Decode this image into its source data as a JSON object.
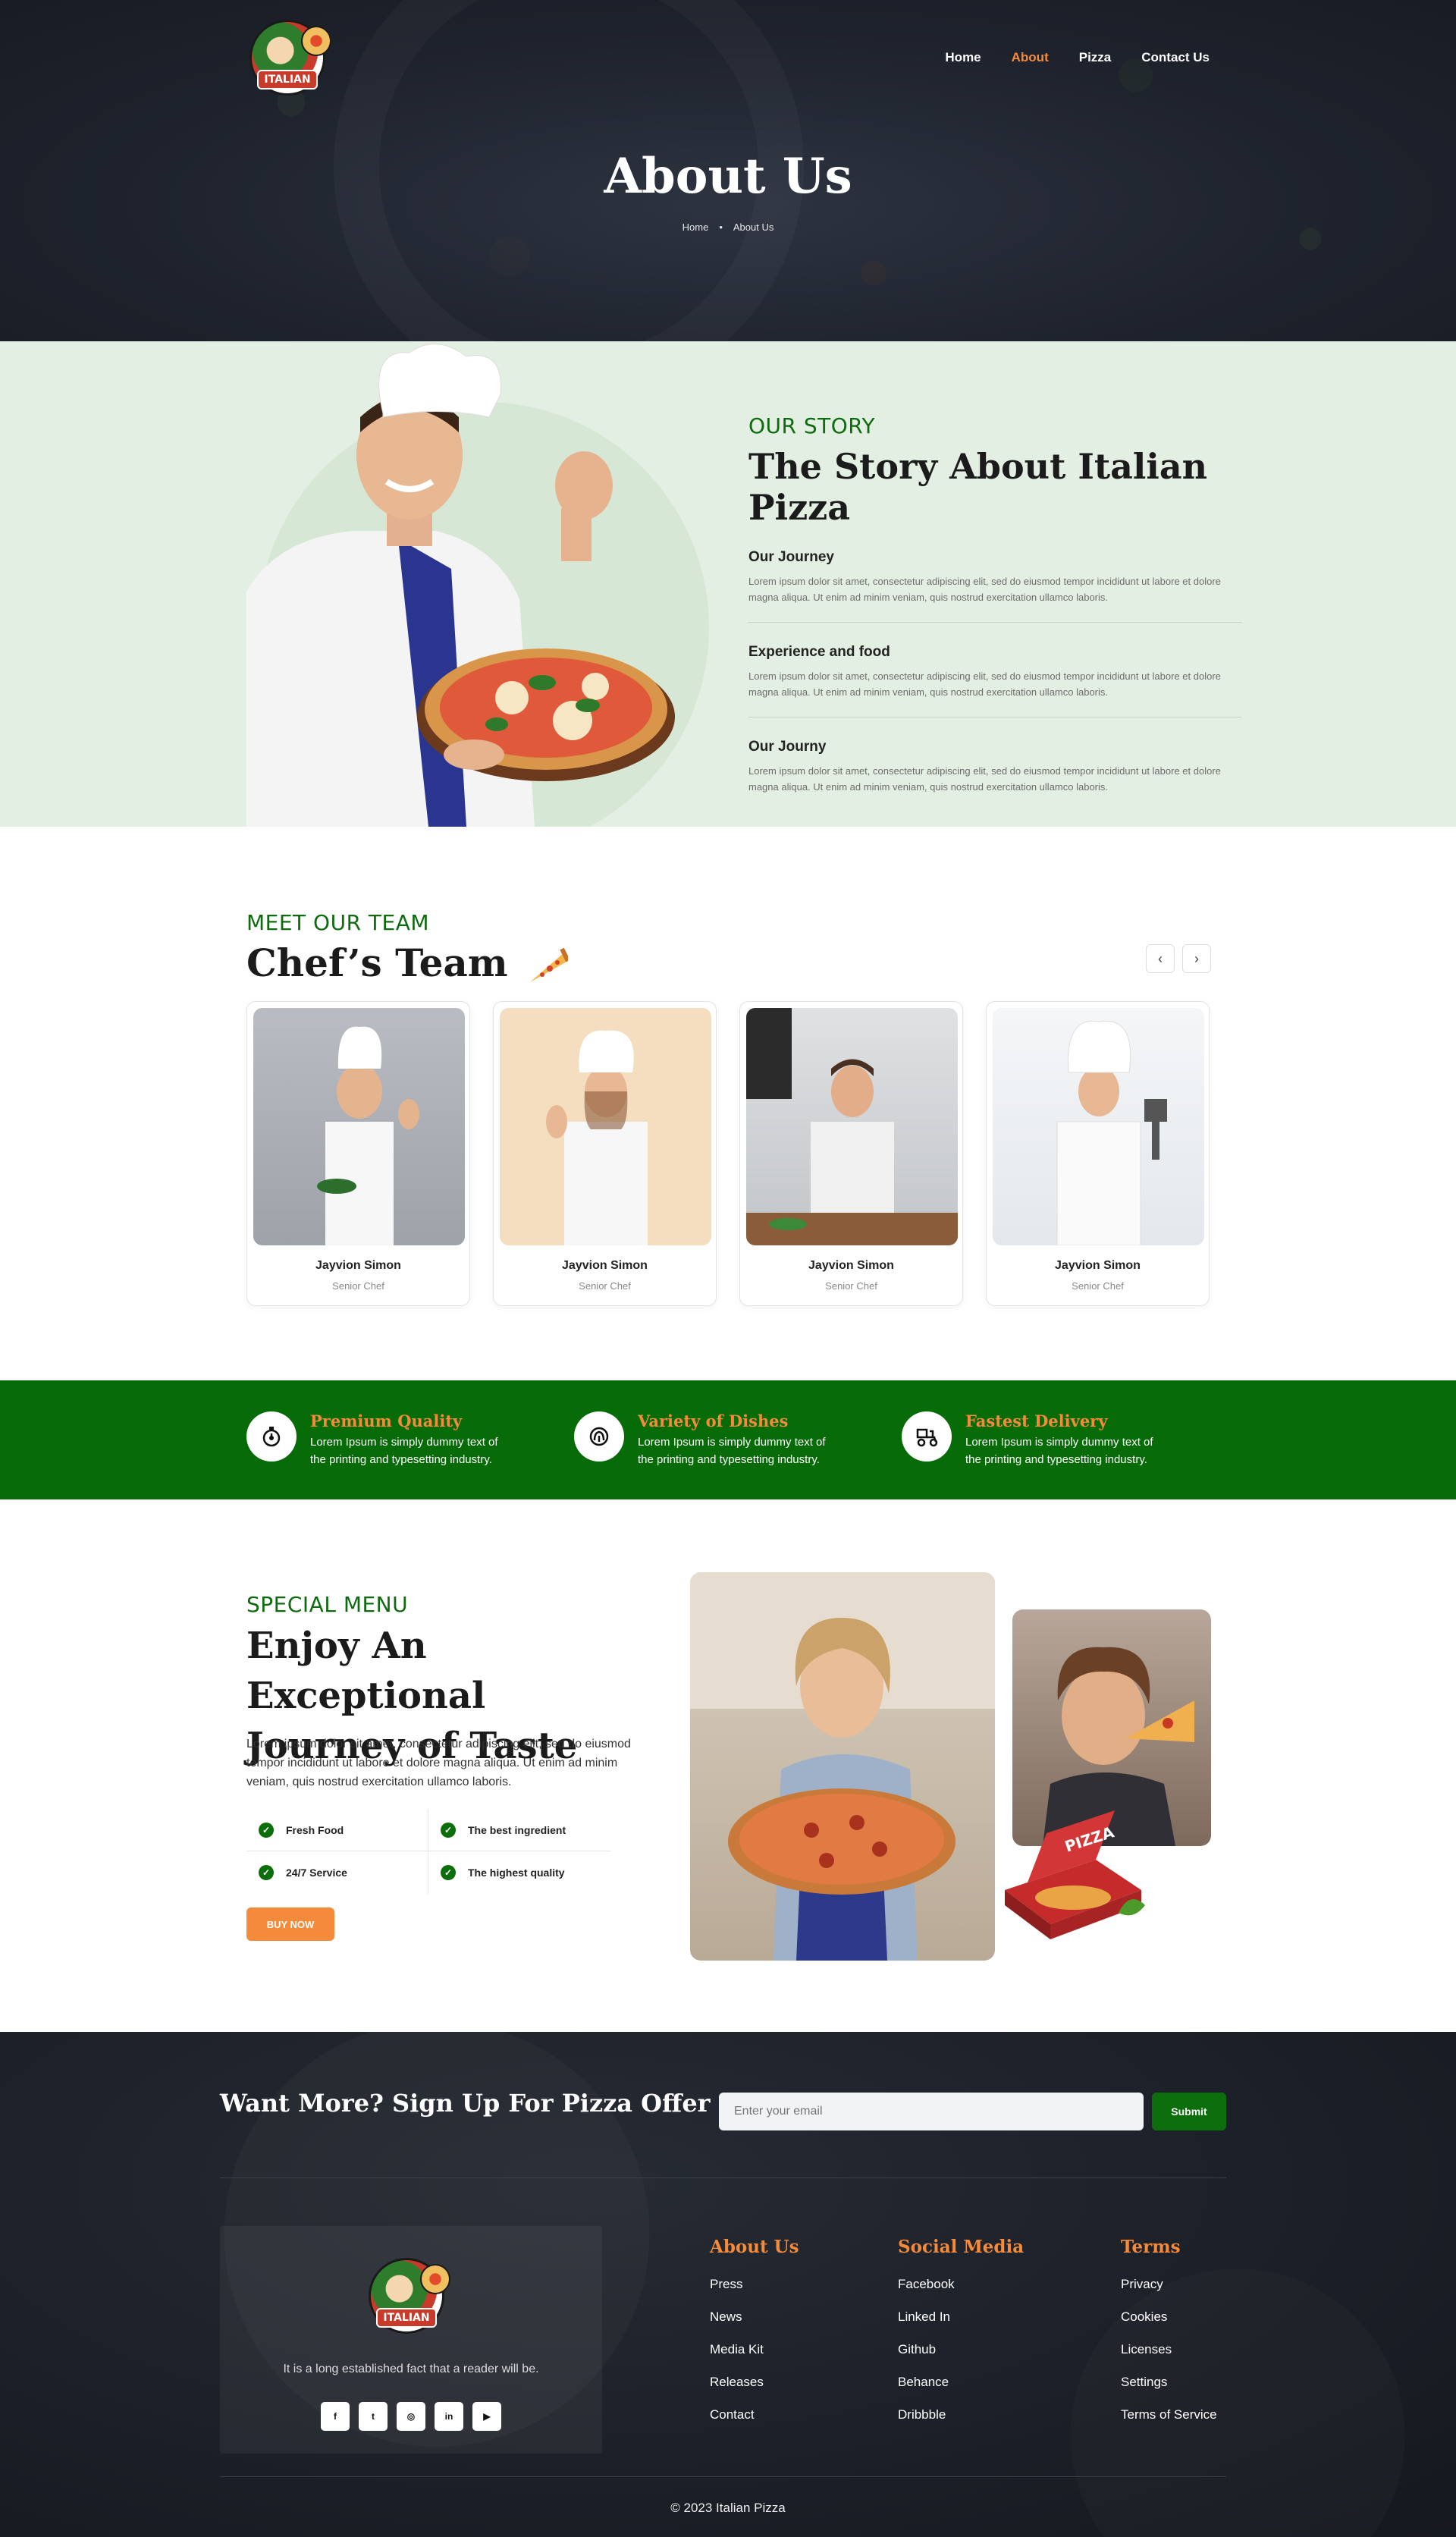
{
  "nav": {
    "logo_text": "ITALIAN",
    "items": [
      {
        "label": "Home",
        "active": false
      },
      {
        "label": "About",
        "active": true
      },
      {
        "label": "Pizza",
        "active": false
      },
      {
        "label": "Contact Us",
        "active": false
      }
    ]
  },
  "hero": {
    "title": "About Us",
    "breadcrumb": [
      "Home",
      "About Us"
    ]
  },
  "story": {
    "eyebrow": "OUR STORY",
    "title": "The Story About Italian Pizza",
    "items": [
      {
        "title": "Our Journey",
        "text": "Lorem ipsum dolor sit amet, consectetur adipiscing elit, sed do eiusmod tempor incididunt ut labore et dolore magna aliqua. Ut enim ad minim veniam, quis nostrud exercitation ullamco laboris."
      },
      {
        "title": "Experience and food",
        "text": "Lorem ipsum dolor sit amet, consectetur adipiscing elit, sed do eiusmod tempor incididunt ut labore et dolore magna aliqua. Ut enim ad minim veniam, quis nostrud exercitation ullamco laboris."
      },
      {
        "title": "Our Journy",
        "text": "Lorem ipsum dolor sit amet, consectetur adipiscing elit, sed do eiusmod tempor incididunt ut labore et dolore magna aliqua. Ut enim ad minim veniam, quis nostrud exercitation ullamco laboris."
      }
    ]
  },
  "team": {
    "eyebrow": "MEET OUR TEAM",
    "title": "Chef’s Team",
    "prev_icon": "chevron-left-icon",
    "next_icon": "chevron-right-icon",
    "members": [
      {
        "name": "Jayvion Simon",
        "role": "Senior Chef"
      },
      {
        "name": "Jayvion Simon",
        "role": "Senior Chef"
      },
      {
        "name": "Jayvion Simon",
        "role": "Senior Chef"
      },
      {
        "name": "Jayvion Simon",
        "role": "Senior Chef"
      }
    ]
  },
  "features": [
    {
      "icon": "timer-icon",
      "title": "Premium Quality",
      "text": "Lorem Ipsum is simply dummy text of the printing and typesetting industry."
    },
    {
      "icon": "dish-icon",
      "title": "Variety of Dishes",
      "text": "Lorem Ipsum is simply dummy text of the printing and typesetting industry."
    },
    {
      "icon": "delivery-icon",
      "title": "Fastest Delivery",
      "text": "Lorem Ipsum is simply dummy text of the printing and typesetting industry."
    }
  ],
  "special": {
    "eyebrow": "SPECIAL MENU",
    "title": "Enjoy An Exceptional Journey of Taste",
    "text": "Lorem ipsum dolor sit amet, consectetur adipiscing elit, sed do eiusmod tempor incididunt ut labore et dolore magna aliqua. Ut enim ad minim veniam, quis nostrud exercitation ullamco laboris.",
    "checks": [
      "Fresh Food",
      "The best ingredient",
      "24/7 Service",
      "The highest quality"
    ],
    "button": "BUY NOW",
    "box_label": "PIZZA"
  },
  "footer": {
    "signup_title": "Want More? Sign Up For Pizza Offer",
    "email_placeholder": "Enter your email",
    "submit": "Submit",
    "tagline": "It is a long established fact that a reader will be.",
    "socials": [
      "facebook-icon",
      "twitter-icon",
      "instagram-icon",
      "linkedin-icon",
      "youtube-icon"
    ],
    "columns": [
      {
        "title": "About Us",
        "links": [
          "Press",
          "News",
          "Media Kit",
          "Releases",
          "Contact"
        ]
      },
      {
        "title": "Social Media",
        "links": [
          "Facebook",
          "Linked In",
          "Github",
          "Behance",
          "Dribbble"
        ]
      },
      {
        "title": "Terms",
        "links": [
          "Privacy",
          "Cookies",
          "Licenses",
          "Settings",
          "Terms of Service"
        ]
      }
    ],
    "copyright": "© 2023 Italian Pizza"
  },
  "colors": {
    "accent": "#f58a3a",
    "green": "#076b07",
    "dark": "#1d222c",
    "mint": "#e4efe3"
  }
}
